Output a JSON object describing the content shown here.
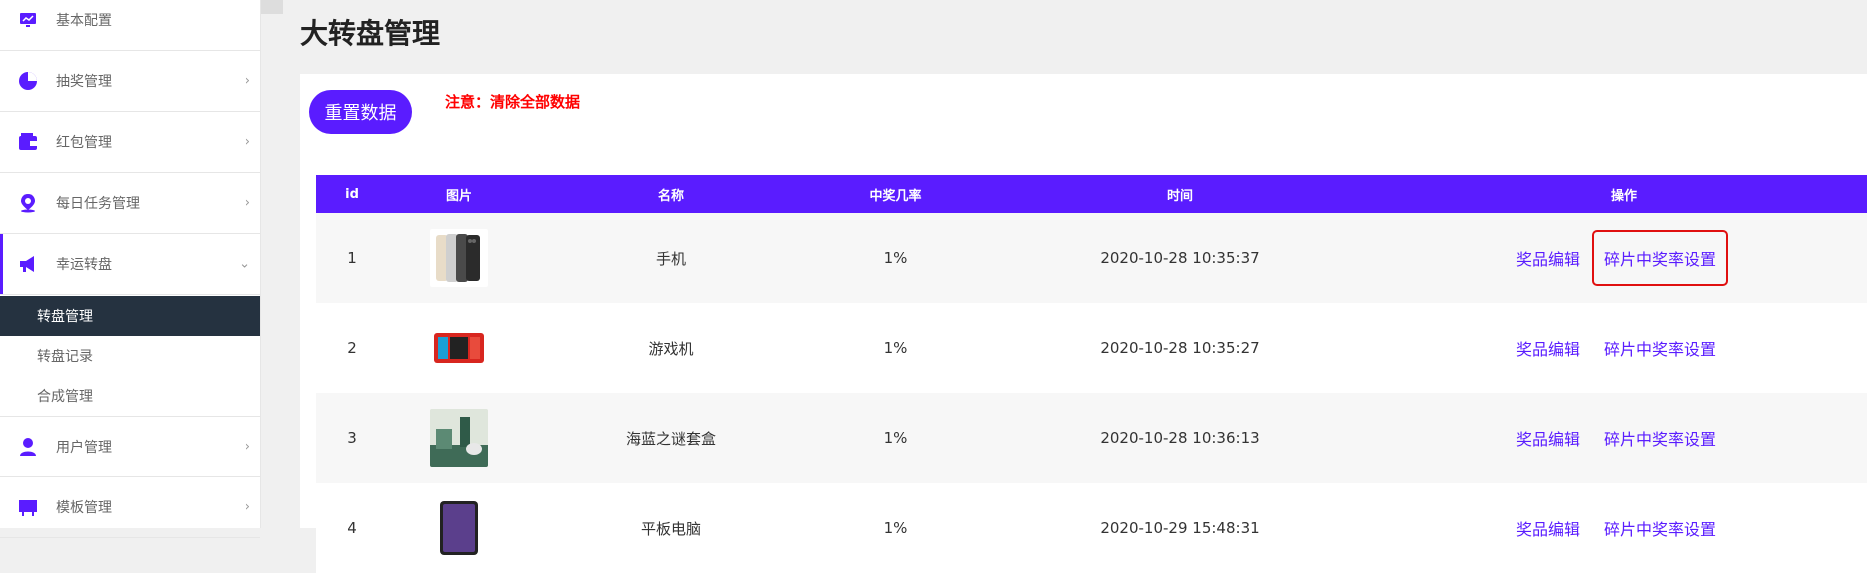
{
  "sidebar": {
    "items": [
      {
        "label": "基本配置",
        "icon": "dashboard-icon"
      },
      {
        "label": "抽奖管理",
        "icon": "pie-chart-icon"
      },
      {
        "label": "红包管理",
        "icon": "wallet-icon"
      },
      {
        "label": "每日任务管理",
        "icon": "map-pin-icon"
      },
      {
        "label": "幸运转盘",
        "icon": "megaphone-icon"
      }
    ],
    "subitems": [
      {
        "label": "转盘管理"
      },
      {
        "label": "转盘记录"
      },
      {
        "label": "合成管理"
      }
    ],
    "lower_items": [
      {
        "label": "用户管理",
        "icon": "user-icon"
      },
      {
        "label": "模板管理",
        "icon": "template-icon"
      }
    ],
    "chevron_right": "›",
    "chevron_down": "⌄"
  },
  "page": {
    "title": "大转盘管理",
    "reset_label": "重置数据",
    "warning": "注意：清除全部数据"
  },
  "table": {
    "headers": [
      "id",
      "图片",
      "名称",
      "中奖几率",
      "时间",
      "操作"
    ],
    "rows": [
      {
        "id": "1",
        "name": "手机",
        "rate": "1%",
        "time": "2020-10-28 10:35:37",
        "image": "phone-image"
      },
      {
        "id": "2",
        "name": "游戏机",
        "rate": "1%",
        "time": "2020-10-28 10:35:27",
        "image": "game-console-image"
      },
      {
        "id": "3",
        "name": "海蓝之谜套盒",
        "rate": "1%",
        "time": "2020-10-28 10:36:13",
        "image": "cosmetics-box-image"
      },
      {
        "id": "4",
        "name": "平板电脑",
        "rate": "1%",
        "time": "2020-10-29 15:48:31",
        "image": "tablet-image"
      }
    ],
    "op_edit": "奖品编辑",
    "op_fragment": "碎片中奖率设置"
  },
  "colors": {
    "accent": "#5a1cff",
    "sidebar_active_bg": "#253240",
    "warning": "#ff0000",
    "highlight_box": "#e01010"
  }
}
